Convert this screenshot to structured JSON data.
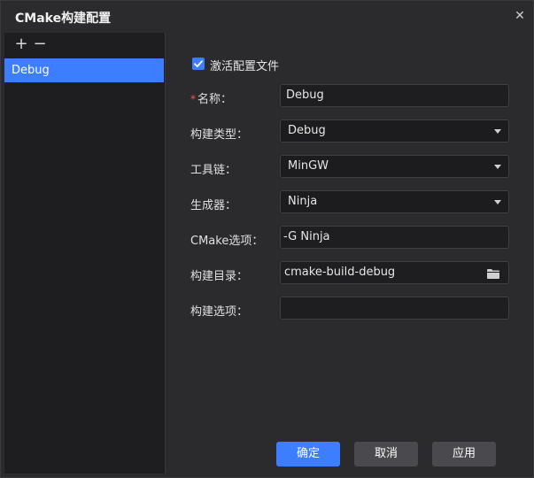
{
  "dialog": {
    "title": "CMake构建配置"
  },
  "left": {
    "add_label": "+",
    "remove_label": "−",
    "items": [
      {
        "label": "Debug",
        "selected": true
      }
    ]
  },
  "form": {
    "activate": {
      "label": "激活配置文件",
      "checked": true
    },
    "name": {
      "required_mark": "*",
      "label": "名称：",
      "value": "Debug"
    },
    "build_type": {
      "label": "构建类型：",
      "value": "Debug"
    },
    "toolchain": {
      "label": "工具链：",
      "value": "MinGW"
    },
    "generator": {
      "label": "生成器：",
      "value": "Ninja"
    },
    "cmake_options": {
      "label": "CMake选项：",
      "value": "-G Ninja"
    },
    "build_dir": {
      "label": "构建目录：",
      "value": "cmake-build-debug"
    },
    "build_options": {
      "label": "构建选项：",
      "value": ""
    }
  },
  "buttons": {
    "ok": "确定",
    "cancel": "取消",
    "apply": "应用"
  },
  "colors": {
    "accent": "#3d7dff",
    "background": "#2b2b2e",
    "panel": "#1e1e20",
    "required": "#ff4d4f"
  },
  "icons": {
    "close": "close-icon",
    "folder": "folder-icon",
    "check": "checkmark-icon",
    "caret": "chevron-down-icon"
  }
}
